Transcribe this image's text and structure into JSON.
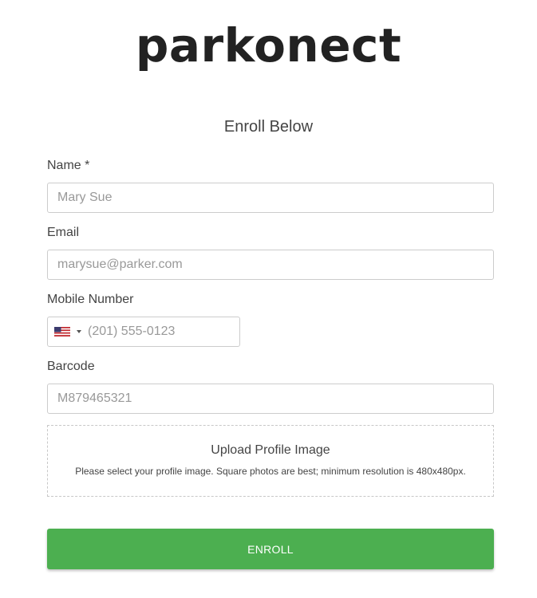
{
  "brand": {
    "logo_text": "parkonect"
  },
  "form": {
    "title": "Enroll Below",
    "name": {
      "label": "Name *",
      "placeholder": "Mary Sue"
    },
    "email": {
      "label": "Email",
      "placeholder": "marysue@parker.com"
    },
    "mobile": {
      "label": "Mobile Number",
      "country_icon": "us-flag-icon",
      "placeholder": "(201) 555-0123"
    },
    "barcode": {
      "label": "Barcode",
      "placeholder": "M879465321"
    },
    "upload": {
      "title": "Upload Profile Image",
      "hint": "Please select your profile image. Square photos are best; minimum resolution is 480x480px."
    },
    "submit_label": "ENROLL"
  },
  "colors": {
    "accent": "#4caf50",
    "text": "#444444",
    "border": "#cccccc"
  }
}
